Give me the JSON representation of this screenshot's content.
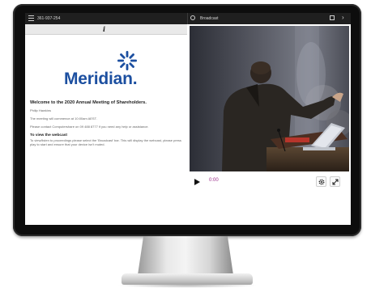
{
  "topbar": {
    "phone": "361-937-254",
    "broadcast_label": "Broadcast"
  },
  "info_icon": "i",
  "logo": {
    "text": "Meridian.",
    "color": "#1c4fa0"
  },
  "content": {
    "welcome": "Welcome to the 2020 Annual Meeting of Shareholders.",
    "name": "Philip Hawkins",
    "commence": "The meeting will commence at 10:00am AEST.",
    "contact": "Please contact Computershare on 09 488 8777 if you need any help or assistance.",
    "view_heading": "To view the webcast",
    "view_text": "To view/listen to proceedings please select the 'Broadcast' bar. This will display the webcast, please press play to start and ensure that your device isn't muted."
  },
  "player": {
    "time": "0:00",
    "time_color": "#9b2d8b"
  },
  "icons": [
    "menu-icon",
    "broadcast-icon",
    "fullscreen-icon",
    "chevron-right-icon",
    "info-icon",
    "play-icon",
    "gear-icon",
    "expand-icon"
  ]
}
